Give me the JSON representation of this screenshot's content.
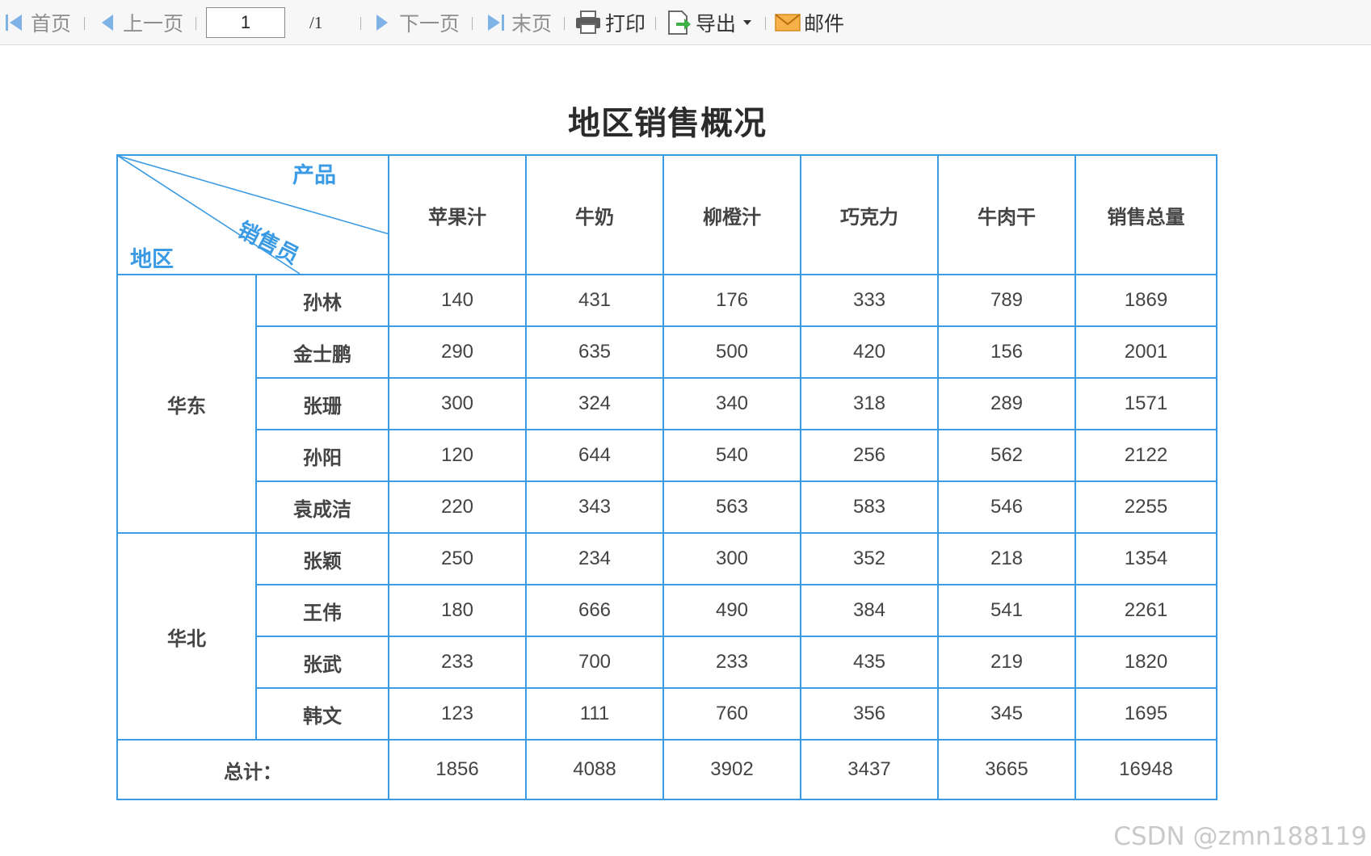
{
  "toolbar": {
    "first_label": "首页",
    "prev_label": "上一页",
    "page_value": "1",
    "page_total": "/1",
    "next_label": "下一页",
    "last_label": "末页",
    "print_label": "打印",
    "export_label": "导出",
    "mail_label": "邮件"
  },
  "report": {
    "title": "地区销售概况",
    "corner": {
      "product": "产品",
      "salesperson": "销售员",
      "region": "地区"
    },
    "columns": [
      "苹果汁",
      "牛奶",
      "柳橙汁",
      "巧克力",
      "牛肉干",
      "销售总量"
    ],
    "regions": [
      {
        "name": "华东",
        "rows": [
          {
            "name": "孙林",
            "values": [
              "140",
              "431",
              "176",
              "333",
              "789",
              "1869"
            ]
          },
          {
            "name": "金士鹏",
            "values": [
              "290",
              "635",
              "500",
              "420",
              "156",
              "2001"
            ]
          },
          {
            "name": "张珊",
            "values": [
              "300",
              "324",
              "340",
              "318",
              "289",
              "1571"
            ]
          },
          {
            "name": "孙阳",
            "values": [
              "120",
              "644",
              "540",
              "256",
              "562",
              "2122"
            ]
          },
          {
            "name": "袁成洁",
            "values": [
              "220",
              "343",
              "563",
              "583",
              "546",
              "2255"
            ]
          }
        ]
      },
      {
        "name": "华北",
        "rows": [
          {
            "name": "张颖",
            "values": [
              "250",
              "234",
              "300",
              "352",
              "218",
              "1354"
            ]
          },
          {
            "name": "王伟",
            "values": [
              "180",
              "666",
              "490",
              "384",
              "541",
              "2261"
            ]
          },
          {
            "name": "张武",
            "values": [
              "233",
              "700",
              "233",
              "435",
              "219",
              "1820"
            ]
          },
          {
            "name": "韩文",
            "values": [
              "123",
              "111",
              "760",
              "356",
              "345",
              "1695"
            ]
          }
        ]
      }
    ],
    "total": {
      "label": "总计：",
      "values": [
        "1856",
        "4088",
        "3902",
        "3437",
        "3665",
        "16948"
      ]
    }
  },
  "watermark": "CSDN @zmn188119",
  "colors": {
    "accent": "#3a9be4",
    "toolbar_bg": "#f7f7f7",
    "export_green": "#3cb043",
    "mail_orange": "#f0a030"
  }
}
